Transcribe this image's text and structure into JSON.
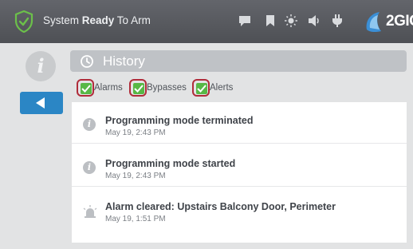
{
  "topbar": {
    "status_prefix": "System ",
    "status_bold": "Ready",
    "status_suffix": " To Arm",
    "brand": "2GIG",
    "icons": [
      "shield-check-icon",
      "message-icon",
      "bookmark-icon",
      "brightness-icon",
      "volume-icon",
      "plug-icon",
      "brand-logo-icon"
    ]
  },
  "sidebar": {
    "info_glyph": "i",
    "back_icon": "back-arrow-icon"
  },
  "history": {
    "title": "History",
    "icon": "history-clock-icon"
  },
  "filters": [
    {
      "label": "Alarms",
      "checked": true
    },
    {
      "label": "Bypasses",
      "checked": true
    },
    {
      "label": "Alerts",
      "checked": true
    }
  ],
  "events": [
    {
      "title": "Programming mode terminated",
      "time": "May 19, 2:43 PM",
      "icon": "info-icon"
    },
    {
      "title": "Programming mode started",
      "time": "May 19, 2:43 PM",
      "icon": "info-icon"
    },
    {
      "title": "Alarm cleared: Upstairs Balcony Door, Perimeter",
      "time": "May 19, 1:51 PM",
      "icon": "alarm-siren-icon"
    }
  ],
  "colors": {
    "topbar": "#55575c",
    "accent_blue": "#2b86c5",
    "check_green": "#57b846",
    "filter_outline": "#b02c3a",
    "shield_green": "#6cc04a"
  }
}
